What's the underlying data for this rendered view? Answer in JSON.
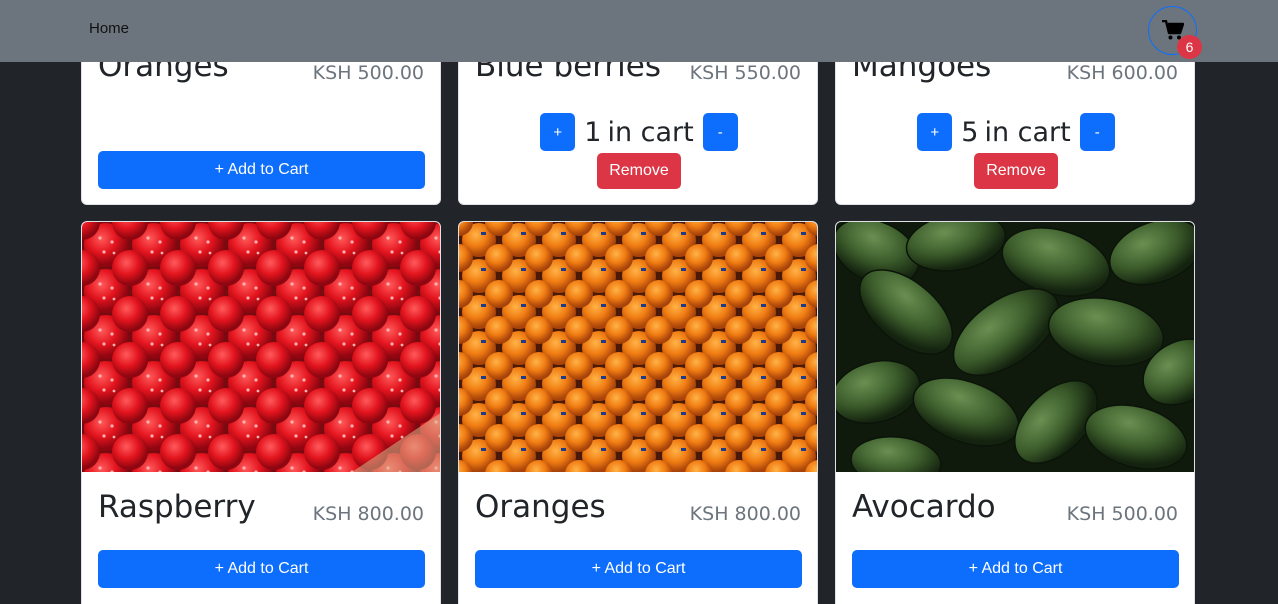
{
  "nav": {
    "home": "Home",
    "cart_count": "6"
  },
  "colors": {
    "primary": "#0d6efd",
    "danger": "#dc3545",
    "navbar": "#6c757d",
    "background": "#212529"
  },
  "products_top": [
    {
      "title": "Oranges",
      "price": "KSH 500.00",
      "add_label": "+ Add to Cart"
    },
    {
      "title": "Blue berries",
      "price": "KSH 550.00",
      "qty": "1",
      "qty_suffix": "in cart",
      "plus": "+",
      "minus": "-",
      "remove_label": "Remove"
    },
    {
      "title": "Mangoes",
      "price": "KSH 600.00",
      "qty": "5",
      "qty_suffix": "in cart",
      "plus": "+",
      "minus": "-",
      "remove_label": "Remove"
    }
  ],
  "products_bottom": [
    {
      "title": "Raspberry",
      "price": "KSH 800.00",
      "add_label": "+ Add to Cart",
      "image_icon": "raspberry-photo"
    },
    {
      "title": "Oranges",
      "price": "KSH 800.00",
      "add_label": "+ Add to Cart",
      "image_icon": "oranges-photo"
    },
    {
      "title": "Avocardo",
      "price": "KSH 500.00",
      "add_label": "+ Add to Cart",
      "image_icon": "avocado-photo"
    }
  ]
}
